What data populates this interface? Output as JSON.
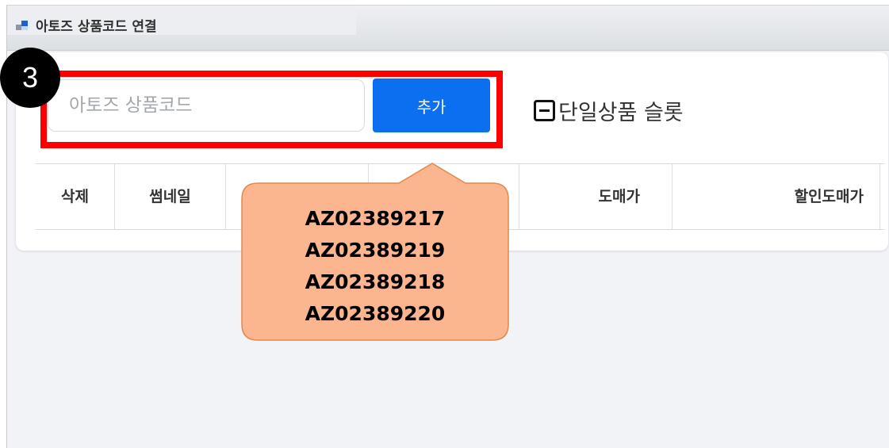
{
  "window": {
    "title": "아토즈 상품코드 연결"
  },
  "toolbar": {
    "code_placeholder": "아토즈 상품코드",
    "add_label": "추가",
    "single_product_label": "단일상품 슬롯"
  },
  "step_number": "3",
  "table": {
    "headers": [
      "삭제",
      "썸네일",
      "",
      "",
      "도매가",
      "할인도매가"
    ]
  },
  "callout": {
    "lines": [
      "AZ02389217",
      "AZ02389219",
      "AZ02389218",
      "AZ02389220"
    ]
  },
  "colors": {
    "primary": "#0b6ff0",
    "highlight": "#ff0000",
    "callout_fill": "#fbb58f",
    "callout_border": "#e08a4c"
  }
}
